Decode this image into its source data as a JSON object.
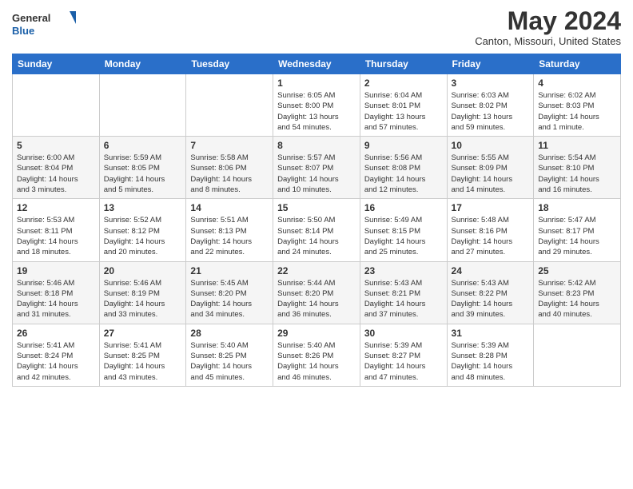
{
  "logo": {
    "general": "General",
    "blue": "Blue"
  },
  "header": {
    "title": "May 2024",
    "location": "Canton, Missouri, United States"
  },
  "weekdays": [
    "Sunday",
    "Monday",
    "Tuesday",
    "Wednesday",
    "Thursday",
    "Friday",
    "Saturday"
  ],
  "weeks": [
    [
      {
        "day": "",
        "info": ""
      },
      {
        "day": "",
        "info": ""
      },
      {
        "day": "",
        "info": ""
      },
      {
        "day": "1",
        "info": "Sunrise: 6:05 AM\nSunset: 8:00 PM\nDaylight: 13 hours\nand 54 minutes."
      },
      {
        "day": "2",
        "info": "Sunrise: 6:04 AM\nSunset: 8:01 PM\nDaylight: 13 hours\nand 57 minutes."
      },
      {
        "day": "3",
        "info": "Sunrise: 6:03 AM\nSunset: 8:02 PM\nDaylight: 13 hours\nand 59 minutes."
      },
      {
        "day": "4",
        "info": "Sunrise: 6:02 AM\nSunset: 8:03 PM\nDaylight: 14 hours\nand 1 minute."
      }
    ],
    [
      {
        "day": "5",
        "info": "Sunrise: 6:00 AM\nSunset: 8:04 PM\nDaylight: 14 hours\nand 3 minutes."
      },
      {
        "day": "6",
        "info": "Sunrise: 5:59 AM\nSunset: 8:05 PM\nDaylight: 14 hours\nand 5 minutes."
      },
      {
        "day": "7",
        "info": "Sunrise: 5:58 AM\nSunset: 8:06 PM\nDaylight: 14 hours\nand 8 minutes."
      },
      {
        "day": "8",
        "info": "Sunrise: 5:57 AM\nSunset: 8:07 PM\nDaylight: 14 hours\nand 10 minutes."
      },
      {
        "day": "9",
        "info": "Sunrise: 5:56 AM\nSunset: 8:08 PM\nDaylight: 14 hours\nand 12 minutes."
      },
      {
        "day": "10",
        "info": "Sunrise: 5:55 AM\nSunset: 8:09 PM\nDaylight: 14 hours\nand 14 minutes."
      },
      {
        "day": "11",
        "info": "Sunrise: 5:54 AM\nSunset: 8:10 PM\nDaylight: 14 hours\nand 16 minutes."
      }
    ],
    [
      {
        "day": "12",
        "info": "Sunrise: 5:53 AM\nSunset: 8:11 PM\nDaylight: 14 hours\nand 18 minutes."
      },
      {
        "day": "13",
        "info": "Sunrise: 5:52 AM\nSunset: 8:12 PM\nDaylight: 14 hours\nand 20 minutes."
      },
      {
        "day": "14",
        "info": "Sunrise: 5:51 AM\nSunset: 8:13 PM\nDaylight: 14 hours\nand 22 minutes."
      },
      {
        "day": "15",
        "info": "Sunrise: 5:50 AM\nSunset: 8:14 PM\nDaylight: 14 hours\nand 24 minutes."
      },
      {
        "day": "16",
        "info": "Sunrise: 5:49 AM\nSunset: 8:15 PM\nDaylight: 14 hours\nand 25 minutes."
      },
      {
        "day": "17",
        "info": "Sunrise: 5:48 AM\nSunset: 8:16 PM\nDaylight: 14 hours\nand 27 minutes."
      },
      {
        "day": "18",
        "info": "Sunrise: 5:47 AM\nSunset: 8:17 PM\nDaylight: 14 hours\nand 29 minutes."
      }
    ],
    [
      {
        "day": "19",
        "info": "Sunrise: 5:46 AM\nSunset: 8:18 PM\nDaylight: 14 hours\nand 31 minutes."
      },
      {
        "day": "20",
        "info": "Sunrise: 5:46 AM\nSunset: 8:19 PM\nDaylight: 14 hours\nand 33 minutes."
      },
      {
        "day": "21",
        "info": "Sunrise: 5:45 AM\nSunset: 8:20 PM\nDaylight: 14 hours\nand 34 minutes."
      },
      {
        "day": "22",
        "info": "Sunrise: 5:44 AM\nSunset: 8:20 PM\nDaylight: 14 hours\nand 36 minutes."
      },
      {
        "day": "23",
        "info": "Sunrise: 5:43 AM\nSunset: 8:21 PM\nDaylight: 14 hours\nand 37 minutes."
      },
      {
        "day": "24",
        "info": "Sunrise: 5:43 AM\nSunset: 8:22 PM\nDaylight: 14 hours\nand 39 minutes."
      },
      {
        "day": "25",
        "info": "Sunrise: 5:42 AM\nSunset: 8:23 PM\nDaylight: 14 hours\nand 40 minutes."
      }
    ],
    [
      {
        "day": "26",
        "info": "Sunrise: 5:41 AM\nSunset: 8:24 PM\nDaylight: 14 hours\nand 42 minutes."
      },
      {
        "day": "27",
        "info": "Sunrise: 5:41 AM\nSunset: 8:25 PM\nDaylight: 14 hours\nand 43 minutes."
      },
      {
        "day": "28",
        "info": "Sunrise: 5:40 AM\nSunset: 8:25 PM\nDaylight: 14 hours\nand 45 minutes."
      },
      {
        "day": "29",
        "info": "Sunrise: 5:40 AM\nSunset: 8:26 PM\nDaylight: 14 hours\nand 46 minutes."
      },
      {
        "day": "30",
        "info": "Sunrise: 5:39 AM\nSunset: 8:27 PM\nDaylight: 14 hours\nand 47 minutes."
      },
      {
        "day": "31",
        "info": "Sunrise: 5:39 AM\nSunset: 8:28 PM\nDaylight: 14 hours\nand 48 minutes."
      },
      {
        "day": "",
        "info": ""
      }
    ]
  ]
}
